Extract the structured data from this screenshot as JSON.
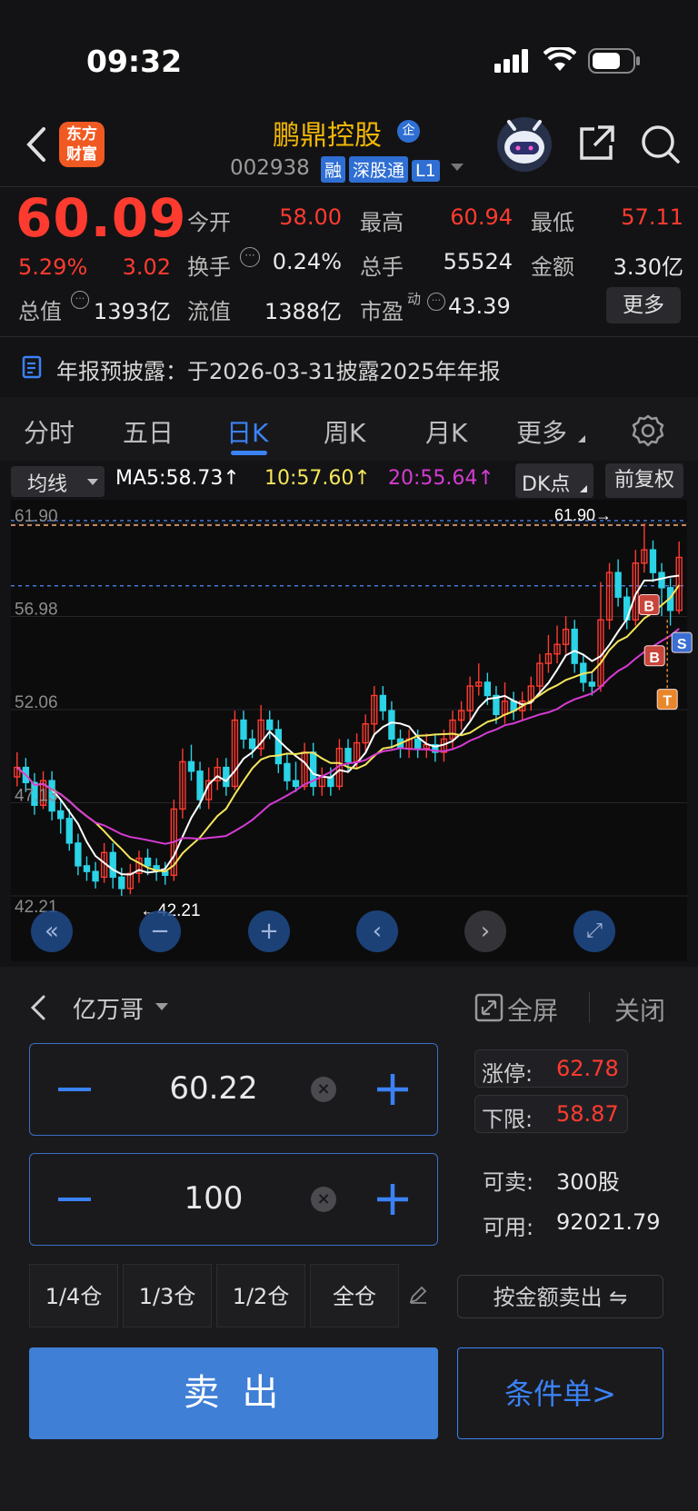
{
  "status_bar": {
    "time": "09:32"
  },
  "header": {
    "logo_line1": "东方",
    "logo_line2": "财富",
    "stock_name": "鹏鼎控股",
    "company_badge": "企",
    "stock_code": "002938",
    "tags": [
      "融",
      "深股通",
      "L1"
    ]
  },
  "quote": {
    "price": "60.09",
    "change_pct": "5.29%",
    "change_amt": "3.02",
    "fields": [
      {
        "label": "今开",
        "value": "58.00",
        "color": "red"
      },
      {
        "label": "最高",
        "value": "60.94",
        "color": "red"
      },
      {
        "label": "最低",
        "value": "57.11",
        "color": "red"
      },
      {
        "label": "换手",
        "value": "0.24%",
        "color": "white"
      },
      {
        "label": "总手",
        "value": "55524",
        "color": "white"
      },
      {
        "label": "金额",
        "value": "3.30亿",
        "color": "white"
      },
      {
        "label": "总值",
        "value": "1393亿",
        "color": "white"
      },
      {
        "label": "流值",
        "value": "1388亿",
        "color": "white"
      },
      {
        "label": "市盈",
        "value": "43.39",
        "color": "white"
      }
    ],
    "pe_superscript": "动",
    "more_button": "更多"
  },
  "notice": {
    "text": "年报预披露：于2026-03-31披露2025年年报"
  },
  "chart_tabs": [
    "分时",
    "五日",
    "日K",
    "周K",
    "月K",
    "更多"
  ],
  "active_tab": "日K",
  "ma_bar": {
    "indicator": "均线",
    "ma5": "MA5:58.73↑",
    "ma10": "10:57.60↑",
    "ma20": "20:55.64↑",
    "dk": "DK点",
    "fq": "前复权"
  },
  "chart_data": {
    "type": "candlestick",
    "y_ticks": [
      "61.90",
      "56.98",
      "52.06",
      "47.13",
      "42.21"
    ],
    "ylim": [
      42.21,
      61.9
    ],
    "max_label": "61.90→",
    "min_label": "←42.21",
    "markers": [
      "B",
      "S",
      "B",
      "T"
    ],
    "candles": [
      [
        48.5,
        49.0,
        49.8,
        48.0
      ],
      [
        49.0,
        48.2,
        49.5,
        47.7
      ],
      [
        48.2,
        47.0,
        48.7,
        46.5
      ],
      [
        47.0,
        48.3,
        48.8,
        46.8
      ],
      [
        48.3,
        46.7,
        48.8,
        46.2
      ],
      [
        46.7,
        46.3,
        47.3,
        45.5
      ],
      [
        46.3,
        45.0,
        46.8,
        44.6
      ],
      [
        45.0,
        43.8,
        45.5,
        43.3
      ],
      [
        43.8,
        43.5,
        44.3,
        43.0
      ],
      [
        43.5,
        43.0,
        44.0,
        42.6
      ],
      [
        43.2,
        44.5,
        45.0,
        42.9
      ],
      [
        44.5,
        43.2,
        45.0,
        42.6
      ],
      [
        43.2,
        42.6,
        43.7,
        42.21
      ],
      [
        42.6,
        43.4,
        43.9,
        42.3
      ],
      [
        43.4,
        44.2,
        44.6,
        42.9
      ],
      [
        44.2,
        43.8,
        44.7,
        43.3
      ],
      [
        43.8,
        43.5,
        44.2,
        43.0
      ],
      [
        43.5,
        43.3,
        44.0,
        42.8
      ],
      [
        43.3,
        46.8,
        47.3,
        43.0
      ],
      [
        46.8,
        49.3,
        50.0,
        46.3
      ],
      [
        49.3,
        48.8,
        50.2,
        48.3
      ],
      [
        48.8,
        47.3,
        49.3,
        46.8
      ],
      [
        47.3,
        48.3,
        49.0,
        46.8
      ],
      [
        48.3,
        49.0,
        49.5,
        47.8
      ],
      [
        49.0,
        48.0,
        49.5,
        47.5
      ],
      [
        48.0,
        51.5,
        52.0,
        47.8
      ],
      [
        51.5,
        50.5,
        52.0,
        50.0
      ],
      [
        50.5,
        50.0,
        51.0,
        49.5
      ],
      [
        50.0,
        51.5,
        52.3,
        49.6
      ],
      [
        51.5,
        51.0,
        52.0,
        50.5
      ],
      [
        51.0,
        49.2,
        51.5,
        48.7
      ],
      [
        49.2,
        48.3,
        49.7,
        47.8
      ],
      [
        48.3,
        48.0,
        49.3,
        47.7
      ],
      [
        48.0,
        49.8,
        50.3,
        47.8
      ],
      [
        49.8,
        48.0,
        50.3,
        47.5
      ],
      [
        48.0,
        48.5,
        49.0,
        47.5
      ],
      [
        48.5,
        48.0,
        49.0,
        47.5
      ],
      [
        48.0,
        50.0,
        50.5,
        47.8
      ],
      [
        50.0,
        49.3,
        50.5,
        48.8
      ],
      [
        49.3,
        50.3,
        50.8,
        48.9
      ],
      [
        50.3,
        51.3,
        51.8,
        49.8
      ],
      [
        51.3,
        52.8,
        53.3,
        50.8
      ],
      [
        52.8,
        52.0,
        53.3,
        51.5
      ],
      [
        52.0,
        50.5,
        52.5,
        50.0
      ],
      [
        50.5,
        50.0,
        51.0,
        49.5
      ],
      [
        50.0,
        50.5,
        51.0,
        49.5
      ],
      [
        50.5,
        50.0,
        51.0,
        49.5
      ],
      [
        50.0,
        50.2,
        50.8,
        49.5
      ],
      [
        50.2,
        49.8,
        50.7,
        49.3
      ],
      [
        49.8,
        50.5,
        51.0,
        49.3
      ],
      [
        50.5,
        51.5,
        52.0,
        50.0
      ],
      [
        51.5,
        52.0,
        52.5,
        51.0
      ],
      [
        52.0,
        53.3,
        53.8,
        51.5
      ],
      [
        53.3,
        53.5,
        54.5,
        52.8
      ],
      [
        53.5,
        52.8,
        54.0,
        52.3
      ],
      [
        52.8,
        51.8,
        53.3,
        51.3
      ],
      [
        51.8,
        52.5,
        53.5,
        51.3
      ],
      [
        52.5,
        52.0,
        53.0,
        51.5
      ],
      [
        52.0,
        52.5,
        53.0,
        51.5
      ],
      [
        52.5,
        53.3,
        53.8,
        52.0
      ],
      [
        53.3,
        54.5,
        55.0,
        52.8
      ],
      [
        54.5,
        55.0,
        56.0,
        54.0
      ],
      [
        55.0,
        55.5,
        56.5,
        54.5
      ],
      [
        55.5,
        56.3,
        57.0,
        55.0
      ],
      [
        56.3,
        54.5,
        56.8,
        54.0
      ],
      [
        54.5,
        53.5,
        55.0,
        53.0
      ],
      [
        53.5,
        53.3,
        54.0,
        52.8
      ],
      [
        53.3,
        56.8,
        58.8,
        53.0
      ],
      [
        56.8,
        59.3,
        59.8,
        56.3
      ],
      [
        59.3,
        58.0,
        60.0,
        57.5
      ],
      [
        58.0,
        56.8,
        58.5,
        56.3
      ],
      [
        56.8,
        59.8,
        60.5,
        56.5
      ],
      [
        59.8,
        60.5,
        61.9,
        59.3
      ],
      [
        60.5,
        59.3,
        61.0,
        58.8
      ],
      [
        59.3,
        58.5,
        59.8,
        57.0
      ],
      [
        58.5,
        57.3,
        59.0,
        56.5
      ],
      [
        57.3,
        60.1,
        60.94,
        57.11
      ]
    ]
  },
  "order": {
    "account": "亿万哥",
    "fullscreen": "全屏",
    "close": "关闭",
    "price": "60.22",
    "quantity": "100",
    "limit_up_label": "涨停:",
    "limit_up": "62.78",
    "limit_down_label": "下限:",
    "limit_down": "58.87",
    "sellable_label": "可卖:",
    "sellable": "300股",
    "available_label": "可用:",
    "available": "92021.79",
    "positions": [
      "1/4仓",
      "1/3仓",
      "1/2仓",
      "全仓"
    ],
    "amount_sell": "按金额卖出 ⇋",
    "sell_button": "卖 出",
    "condition_button": "条件单>"
  },
  "colors": {
    "up": "#ff3b30",
    "down": "#2bd3e6",
    "accent": "#3b82f6",
    "ma5": "#ffffff",
    "ma10": "#f5e65a",
    "ma20": "#d63bd3"
  }
}
